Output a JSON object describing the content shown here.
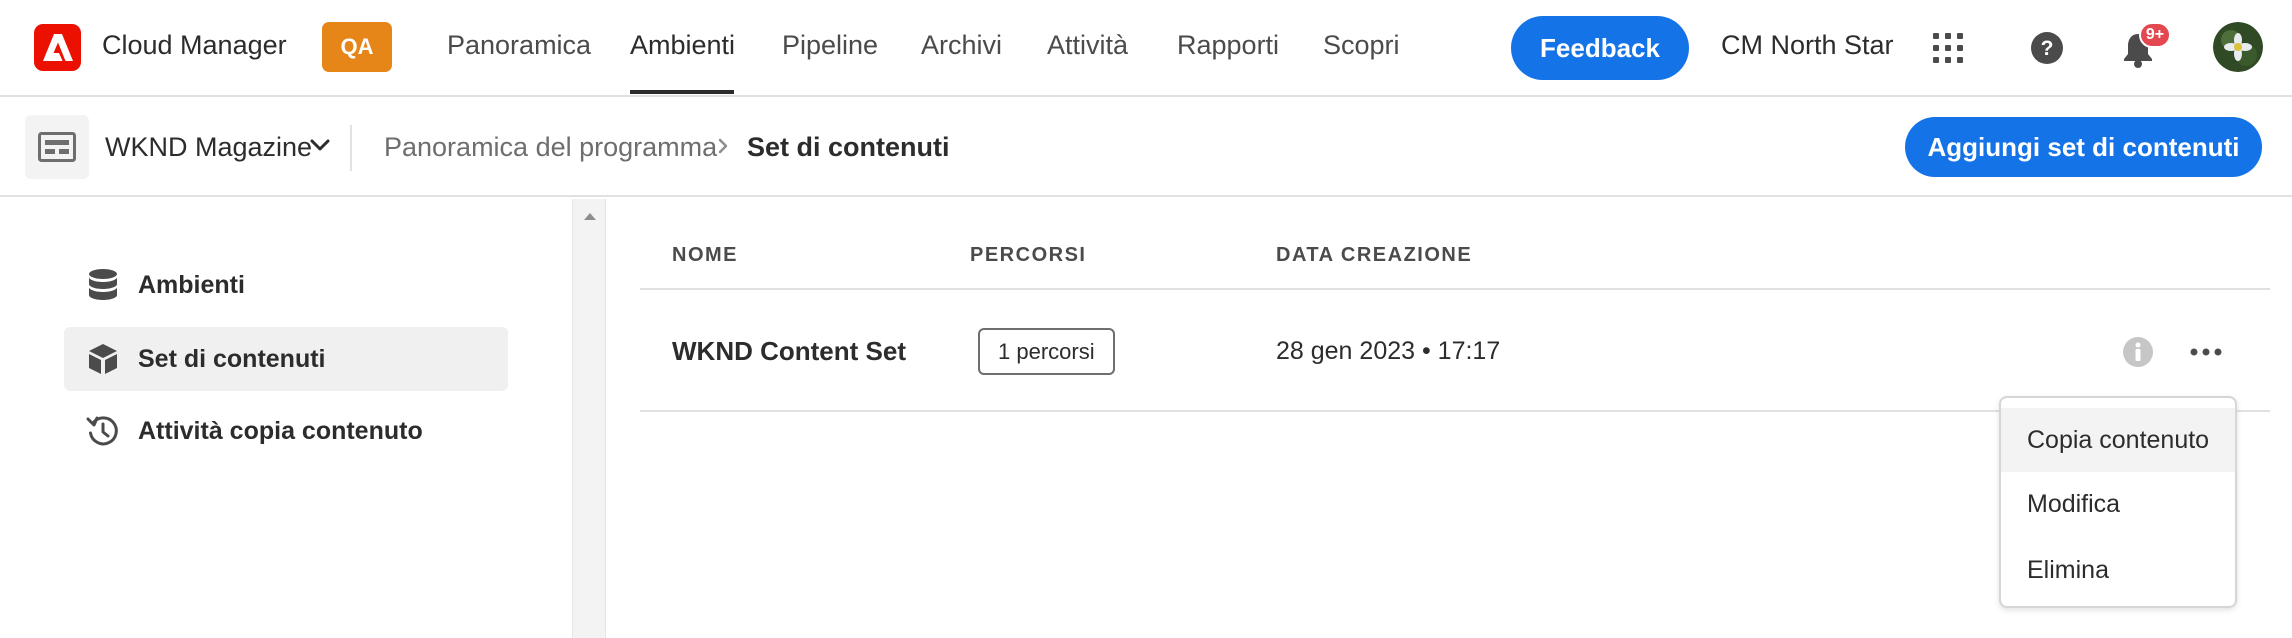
{
  "header": {
    "app_title": "Cloud Manager",
    "env_badge": "QA",
    "nav_tabs": [
      {
        "label": "Panoramica",
        "active": false
      },
      {
        "label": "Ambienti",
        "active": true
      },
      {
        "label": "Pipeline",
        "active": false
      },
      {
        "label": "Archivi",
        "active": false
      },
      {
        "label": "Attività",
        "active": false
      },
      {
        "label": "Rapporti",
        "active": false
      },
      {
        "label": "Scopri",
        "active": false
      }
    ],
    "feedback_label": "Feedback",
    "org_name": "CM North Star",
    "notification_count": "9+",
    "icons": [
      "adobe-logo",
      "apps-grid-icon",
      "help-icon",
      "bell-icon",
      "user-avatar"
    ]
  },
  "subheader": {
    "program_name": "WKND Magazine",
    "breadcrumb": [
      "Panoramica del programma",
      "Set di contenuti"
    ],
    "add_button_label": "Aggiungi set di contenuti"
  },
  "sidebar": {
    "items": [
      {
        "label": "Ambienti",
        "icon": "database-icon",
        "active": false
      },
      {
        "label": "Set di contenuti",
        "icon": "content-set-icon",
        "active": true
      },
      {
        "label": "Attività copia contenuto",
        "icon": "history-icon",
        "active": false
      }
    ]
  },
  "table": {
    "columns": [
      "NOME",
      "PERCORSI",
      "DATA CREAZIONE"
    ],
    "rows": [
      {
        "name": "WKND Content Set",
        "paths": "1 percorsi",
        "created": "28 gen 2023 • 17:17"
      }
    ]
  },
  "row_menu": {
    "items": [
      "Copia contenuto",
      "Modifica",
      "Elimina"
    ]
  },
  "colors": {
    "accent": "#1473e6",
    "adobe_red": "#eb1000",
    "qa_badge": "#e68619",
    "notification_badge": "#e34850"
  }
}
